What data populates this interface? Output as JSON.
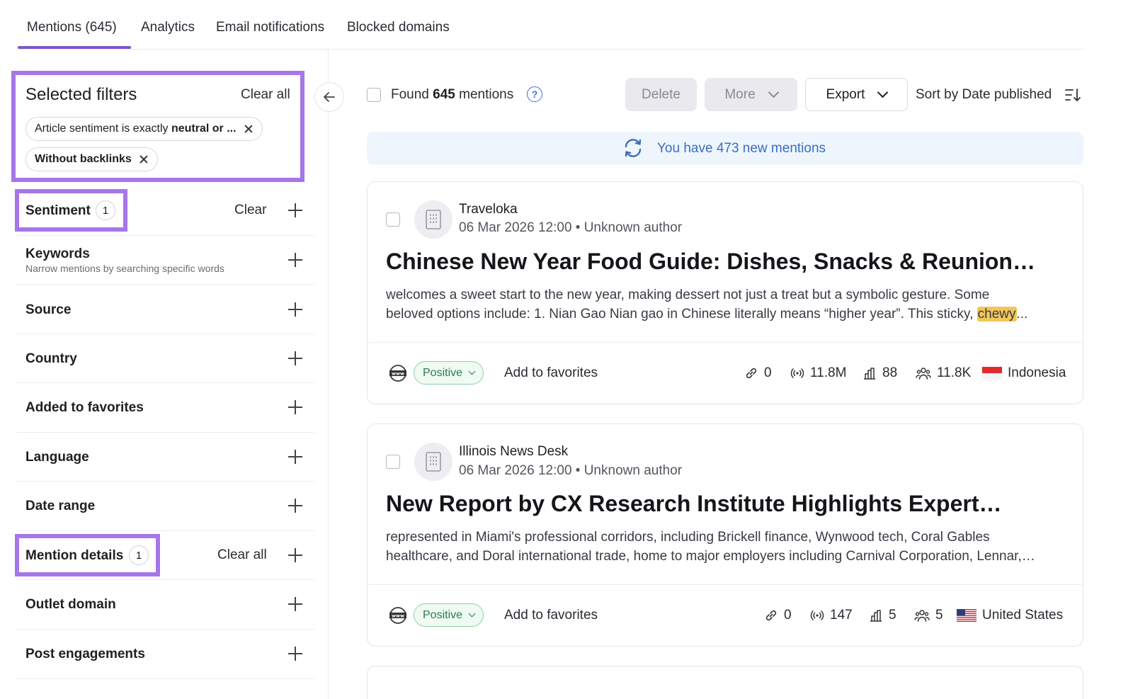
{
  "tabs": [
    {
      "label": "Mentions (645)"
    },
    {
      "label": "Analytics"
    },
    {
      "label": "Email notifications"
    },
    {
      "label": "Blocked domains"
    }
  ],
  "selected_filters": {
    "title": "Selected filters",
    "clear_all": "Clear all",
    "chip1_prefix": "Article sentiment is exactly ",
    "chip1_bold": "neutral or ...",
    "chip2": "Without backlinks"
  },
  "filters": {
    "sentiment": {
      "label": "Sentiment",
      "count": "1",
      "clear": "Clear"
    },
    "keywords": {
      "label": "Keywords",
      "sub": "Narrow mentions by searching specific words"
    },
    "source": {
      "label": "Source"
    },
    "country": {
      "label": "Country"
    },
    "favorites": {
      "label": "Added to favorites"
    },
    "language": {
      "label": "Language"
    },
    "date_range": {
      "label": "Date range"
    },
    "mention_details": {
      "label": "Mention details",
      "count": "1",
      "clear": "Clear all"
    },
    "outlet_domain": {
      "label": "Outlet domain"
    },
    "post_engagements": {
      "label": "Post engagements"
    }
  },
  "toolbar": {
    "found_prefix": "Found ",
    "found_count": "645",
    "found_suffix": " mentions",
    "help": "?",
    "delete": "Delete",
    "more": "More",
    "export": "Export",
    "sort": "Sort by Date published"
  },
  "banner": {
    "text": "You have 473 new mentions"
  },
  "mentions": [
    {
      "source": "Traveloka",
      "meta": "06 Mar 2026 12:00 • Unknown author",
      "title": "Chinese New Year Food Guide: Dishes, Snacks & Reunion…",
      "snippet_line1": "welcomes a sweet start to the new year, making dessert not just a treat but a symbolic gesture. Some",
      "snippet_line2": "beloved options include: 1. Nian Gao Nian gao in Chinese literally means “higher year”. This sticky, ",
      "snippet_highlight": "chewy",
      "snippet_end": "...",
      "sentiment": "Positive",
      "favorites": "Add to favorites",
      "backlinks": "0",
      "reach": "11.8M",
      "authority": "88",
      "audience": "11.8K",
      "country": "Indonesia"
    },
    {
      "source": "Illinois News Desk",
      "meta": "06 Mar 2026 12:00 • Unknown author",
      "title": "New Report by CX Research Institute Highlights Expert…",
      "snippet_line1": "represented in Miami's professional corridors, including Brickell finance, Wynwood tech, Coral Gables",
      "snippet_line2": "healthcare, and Doral international trade, home to major employers including Carnival Corporation, Lennar,…",
      "sentiment": "Positive",
      "favorites": "Add to favorites",
      "backlinks": "0",
      "reach": "147",
      "authority": "5",
      "audience": "5",
      "country": "United States"
    }
  ],
  "colors": {
    "accent": "#7a59c8",
    "highlight_box": "#a776ea",
    "positive": "#2d7b50",
    "banner_text": "#3c6ec0"
  }
}
